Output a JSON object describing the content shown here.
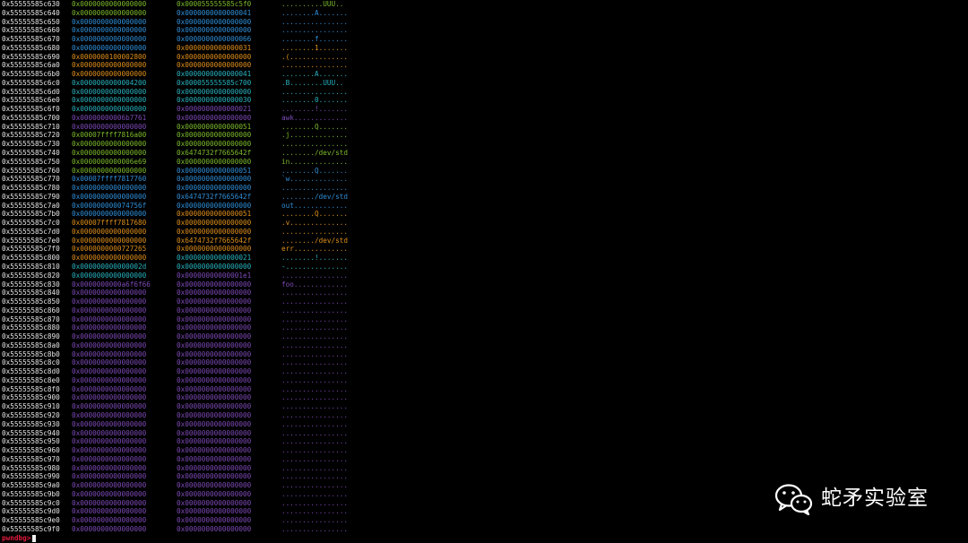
{
  "palette": {
    "bg": "#000000",
    "address": "#e6e6e6",
    "prompt": "#e01b3c",
    "green": "#7dbb2c",
    "blue": "#2f8fd9",
    "orange": "#e08f1a",
    "teal": "#29b3c0",
    "purple": "#7d4ab7"
  },
  "rows": [
    {
      "addr": "0x55555585c630",
      "q1": "0x0000000000000000",
      "c1": "green",
      "q2": "0x000055555585c5f0",
      "c2": "green",
      "ascii": "..........UUU..",
      "c3": "green"
    },
    {
      "addr": "0x55555585c640",
      "q1": "0x0000000000000000",
      "c1": "green",
      "q2": "0x0000000000000041",
      "c2": "blue",
      "ascii": "........A.......",
      "c3": "blue"
    },
    {
      "addr": "0x55555585c650",
      "q1": "0x0000000000000000",
      "c1": "blue",
      "q2": "0x0000000000000000",
      "c2": "blue",
      "ascii": "................",
      "c3": "blue"
    },
    {
      "addr": "0x55555585c660",
      "q1": "0x0000000000000000",
      "c1": "blue",
      "q2": "0x0000000000000000",
      "c2": "blue",
      "ascii": "................",
      "c3": "blue"
    },
    {
      "addr": "0x55555585c670",
      "q1": "0x0000000000000000",
      "c1": "blue",
      "q2": "0x0000000000000066",
      "c2": "blue",
      "ascii": "........f.......",
      "c3": "blue"
    },
    {
      "addr": "0x55555585c680",
      "q1": "0x0000000000000000",
      "c1": "blue",
      "q2": "0x0000000000000031",
      "c2": "orange",
      "ascii": "........1.......",
      "c3": "orange"
    },
    {
      "addr": "0x55555585c690",
      "q1": "0x0000000100002800",
      "c1": "orange",
      "q2": "0x0000000000000000",
      "c2": "orange",
      "ascii": ".(..............",
      "c3": "orange"
    },
    {
      "addr": "0x55555585c6a0",
      "q1": "0x0000000000000000",
      "c1": "orange",
      "q2": "0x0000000000000000",
      "c2": "orange",
      "ascii": "................",
      "c3": "orange"
    },
    {
      "addr": "0x55555585c6b0",
      "q1": "0x0000000000000000",
      "c1": "orange",
      "q2": "0x0000000000000041",
      "c2": "teal",
      "ascii": "........A.......",
      "c3": "teal"
    },
    {
      "addr": "0x55555585c6c0",
      "q1": "0x0000000000004200",
      "c1": "teal",
      "q2": "0x000055555585c700",
      "c2": "teal",
      "ascii": ".B........UUU..",
      "c3": "teal"
    },
    {
      "addr": "0x55555585c6d0",
      "q1": "0x0000000000000000",
      "c1": "teal",
      "q2": "0x0000000000000000",
      "c2": "teal",
      "ascii": "................",
      "c3": "teal"
    },
    {
      "addr": "0x55555585c6e0",
      "q1": "0x0000000000000000",
      "c1": "teal",
      "q2": "0x0000000000000030",
      "c2": "teal",
      "ascii": "........0.......",
      "c3": "teal"
    },
    {
      "addr": "0x55555585c6f0",
      "q1": "0x0000000000000000",
      "c1": "teal",
      "q2": "0x0000000000000021",
      "c2": "purple",
      "ascii": "........!.......",
      "c3": "purple"
    },
    {
      "addr": "0x55555585c700",
      "q1": "0x00000000006b7761",
      "c1": "purple",
      "q2": "0x0000000000000000",
      "c2": "purple",
      "ascii": "awk.............",
      "c3": "purple"
    },
    {
      "addr": "0x55555585c710",
      "q1": "0x0000000000000000",
      "c1": "purple",
      "q2": "0x0000000000000051",
      "c2": "green",
      "ascii": "........Q.......",
      "c3": "green"
    },
    {
      "addr": "0x55555585c720",
      "q1": "0x00007ffff7816a00",
      "c1": "green",
      "q2": "0x0000000000000000",
      "c2": "green",
      "ascii": ".j..............",
      "c3": "green"
    },
    {
      "addr": "0x55555585c730",
      "q1": "0x0000000000000000",
      "c1": "green",
      "q2": "0x0000000000000000",
      "c2": "green",
      "ascii": "................",
      "c3": "green"
    },
    {
      "addr": "0x55555585c740",
      "q1": "0x0000000000000000",
      "c1": "green",
      "q2": "0x6474732f7665642f",
      "c2": "green",
      "ascii": "......../dev/std",
      "c3": "green"
    },
    {
      "addr": "0x55555585c750",
      "q1": "0x0000000000006e69",
      "c1": "green",
      "q2": "0x0000000000000000",
      "c2": "green",
      "ascii": "in..............",
      "c3": "green"
    },
    {
      "addr": "0x55555585c760",
      "q1": "0x0000000000000000",
      "c1": "green",
      "q2": "0x0000000000000051",
      "c2": "blue",
      "ascii": "........Q.......",
      "c3": "blue"
    },
    {
      "addr": "0x55555585c770",
      "q1": "0x00007ffff7817760",
      "c1": "blue",
      "q2": "0x0000000000000000",
      "c2": "blue",
      "ascii": "`w..............",
      "c3": "blue"
    },
    {
      "addr": "0x55555585c780",
      "q1": "0x0000000000000000",
      "c1": "blue",
      "q2": "0x0000000000000000",
      "c2": "blue",
      "ascii": "................",
      "c3": "blue"
    },
    {
      "addr": "0x55555585c790",
      "q1": "0x0000000000000000",
      "c1": "blue",
      "q2": "0x6474732f7665642f",
      "c2": "blue",
      "ascii": "......../dev/std",
      "c3": "blue"
    },
    {
      "addr": "0x55555585c7a0",
      "q1": "0x000000000074756f",
      "c1": "blue",
      "q2": "0x0000000000000000",
      "c2": "blue",
      "ascii": "out.............",
      "c3": "blue"
    },
    {
      "addr": "0x55555585c7b0",
      "q1": "0x0000000000000000",
      "c1": "blue",
      "q2": "0x0000000000000051",
      "c2": "orange",
      "ascii": "........Q.......",
      "c3": "orange"
    },
    {
      "addr": "0x55555585c7c0",
      "q1": "0x00007ffff7817680",
      "c1": "orange",
      "q2": "0x0000000000000000",
      "c2": "orange",
      "ascii": ".v..............",
      "c3": "orange"
    },
    {
      "addr": "0x55555585c7d0",
      "q1": "0x0000000000000000",
      "c1": "orange",
      "q2": "0x0000000000000000",
      "c2": "orange",
      "ascii": "................",
      "c3": "orange"
    },
    {
      "addr": "0x55555585c7e0",
      "q1": "0x0000000000000000",
      "c1": "orange",
      "q2": "0x6474732f7665642f",
      "c2": "orange",
      "ascii": "......../dev/std",
      "c3": "orange"
    },
    {
      "addr": "0x55555585c7f0",
      "q1": "0x0000000000727265",
      "c1": "orange",
      "q2": "0x0000000000000000",
      "c2": "orange",
      "ascii": "err.............",
      "c3": "orange"
    },
    {
      "addr": "0x55555585c800",
      "q1": "0x0000000000000000",
      "c1": "orange",
      "q2": "0x0000000000000021",
      "c2": "teal",
      "ascii": "........!.......",
      "c3": "teal"
    },
    {
      "addr": "0x55555585c810",
      "q1": "0x000000000000002d",
      "c1": "teal",
      "q2": "0x0000000000000000",
      "c2": "teal",
      "ascii": "-...............",
      "c3": "teal"
    },
    {
      "addr": "0x55555585c820",
      "q1": "0x0000000000000000",
      "c1": "teal",
      "q2": "0x00000000000001e1",
      "c2": "purple",
      "ascii": "................",
      "c3": "purple"
    },
    {
      "addr": "0x55555585c830",
      "q1": "0x0000000000a6f6f66",
      "c1": "purple",
      "q2": "0x0000000000000000",
      "c2": "purple",
      "ascii": "foo.............",
      "c3": "purple"
    },
    {
      "addr": "0x55555585c840",
      "q1": "0x0000000000000000",
      "c1": "purple",
      "q2": "0x0000000000000000",
      "c2": "purple",
      "ascii": "................",
      "c3": "purple"
    },
    {
      "addr": "0x55555585c850",
      "q1": "0x0000000000000000",
      "c1": "purple",
      "q2": "0x0000000000000000",
      "c2": "purple",
      "ascii": "................",
      "c3": "purple"
    },
    {
      "addr": "0x55555585c860",
      "q1": "0x0000000000000000",
      "c1": "purple",
      "q2": "0x0000000000000000",
      "c2": "purple",
      "ascii": "................",
      "c3": "purple"
    },
    {
      "addr": "0x55555585c870",
      "q1": "0x0000000000000000",
      "c1": "purple",
      "q2": "0x0000000000000000",
      "c2": "purple",
      "ascii": "................",
      "c3": "purple"
    },
    {
      "addr": "0x55555585c880",
      "q1": "0x0000000000000000",
      "c1": "purple",
      "q2": "0x0000000000000000",
      "c2": "purple",
      "ascii": "................",
      "c3": "purple"
    },
    {
      "addr": "0x55555585c890",
      "q1": "0x0000000000000000",
      "c1": "purple",
      "q2": "0x0000000000000000",
      "c2": "purple",
      "ascii": "................",
      "c3": "purple"
    },
    {
      "addr": "0x55555585c8a0",
      "q1": "0x0000000000000000",
      "c1": "purple",
      "q2": "0x0000000000000000",
      "c2": "purple",
      "ascii": "................",
      "c3": "purple"
    },
    {
      "addr": "0x55555585c8b0",
      "q1": "0x0000000000000000",
      "c1": "purple",
      "q2": "0x0000000000000000",
      "c2": "purple",
      "ascii": "................",
      "c3": "purple"
    },
    {
      "addr": "0x55555585c8c0",
      "q1": "0x0000000000000000",
      "c1": "purple",
      "q2": "0x0000000000000000",
      "c2": "purple",
      "ascii": "................",
      "c3": "purple"
    },
    {
      "addr": "0x55555585c8d0",
      "q1": "0x0000000000000000",
      "c1": "purple",
      "q2": "0x0000000000000000",
      "c2": "purple",
      "ascii": "................",
      "c3": "purple"
    },
    {
      "addr": "0x55555585c8e0",
      "q1": "0x0000000000000000",
      "c1": "purple",
      "q2": "0x0000000000000000",
      "c2": "purple",
      "ascii": "................",
      "c3": "purple"
    },
    {
      "addr": "0x55555585c8f0",
      "q1": "0x0000000000000000",
      "c1": "purple",
      "q2": "0x0000000000000000",
      "c2": "purple",
      "ascii": "................",
      "c3": "purple"
    },
    {
      "addr": "0x55555585c900",
      "q1": "0x0000000000000000",
      "c1": "purple",
      "q2": "0x0000000000000000",
      "c2": "purple",
      "ascii": "................",
      "c3": "purple"
    },
    {
      "addr": "0x55555585c910",
      "q1": "0x0000000000000000",
      "c1": "purple",
      "q2": "0x0000000000000000",
      "c2": "purple",
      "ascii": "................",
      "c3": "purple"
    },
    {
      "addr": "0x55555585c920",
      "q1": "0x0000000000000000",
      "c1": "purple",
      "q2": "0x0000000000000000",
      "c2": "purple",
      "ascii": "................",
      "c3": "purple"
    },
    {
      "addr": "0x55555585c930",
      "q1": "0x0000000000000000",
      "c1": "purple",
      "q2": "0x0000000000000000",
      "c2": "purple",
      "ascii": "................",
      "c3": "purple"
    },
    {
      "addr": "0x55555585c940",
      "q1": "0x0000000000000000",
      "c1": "purple",
      "q2": "0x0000000000000000",
      "c2": "purple",
      "ascii": "................",
      "c3": "purple"
    },
    {
      "addr": "0x55555585c950",
      "q1": "0x0000000000000000",
      "c1": "purple",
      "q2": "0x0000000000000000",
      "c2": "purple",
      "ascii": "................",
      "c3": "purple"
    },
    {
      "addr": "0x55555585c960",
      "q1": "0x0000000000000000",
      "c1": "purple",
      "q2": "0x0000000000000000",
      "c2": "purple",
      "ascii": "................",
      "c3": "purple"
    },
    {
      "addr": "0x55555585c970",
      "q1": "0x0000000000000000",
      "c1": "purple",
      "q2": "0x0000000000000000",
      "c2": "purple",
      "ascii": "................",
      "c3": "purple"
    },
    {
      "addr": "0x55555585c980",
      "q1": "0x0000000000000000",
      "c1": "purple",
      "q2": "0x0000000000000000",
      "c2": "purple",
      "ascii": "................",
      "c3": "purple"
    },
    {
      "addr": "0x55555585c990",
      "q1": "0x0000000000000000",
      "c1": "purple",
      "q2": "0x0000000000000000",
      "c2": "purple",
      "ascii": "................",
      "c3": "purple"
    },
    {
      "addr": "0x55555585c9a0",
      "q1": "0x0000000000000000",
      "c1": "purple",
      "q2": "0x0000000000000000",
      "c2": "purple",
      "ascii": "................",
      "c3": "purple"
    },
    {
      "addr": "0x55555585c9b0",
      "q1": "0x0000000000000000",
      "c1": "purple",
      "q2": "0x0000000000000000",
      "c2": "purple",
      "ascii": "................",
      "c3": "purple"
    },
    {
      "addr": "0x55555585c9c0",
      "q1": "0x0000000000000000",
      "c1": "purple",
      "q2": "0x0000000000000000",
      "c2": "purple",
      "ascii": "................",
      "c3": "purple"
    },
    {
      "addr": "0x55555585c9d0",
      "q1": "0x0000000000000000",
      "c1": "purple",
      "q2": "0x0000000000000000",
      "c2": "purple",
      "ascii": "................",
      "c3": "purple"
    },
    {
      "addr": "0x55555585c9e0",
      "q1": "0x0000000000000000",
      "c1": "purple",
      "q2": "0x0000000000000000",
      "c2": "purple",
      "ascii": "................",
      "c3": "purple"
    },
    {
      "addr": "0x55555585c9f0",
      "q1": "0x0000000000000000",
      "c1": "purple",
      "q2": "0x0000000000000000",
      "c2": "purple",
      "ascii": "................",
      "c3": "purple"
    }
  ],
  "prompt": "pwndbg>",
  "watermark": {
    "text": "蛇矛实验室",
    "icon": "wechat-icon"
  }
}
